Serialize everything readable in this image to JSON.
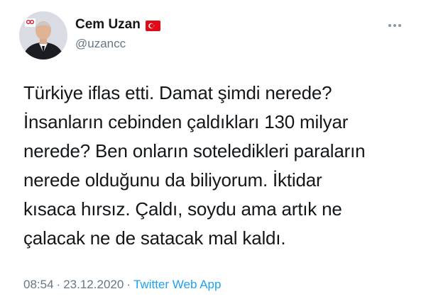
{
  "author": {
    "display_name": "Cem Uzan",
    "handle": "@uzancc",
    "flag_icon": "turkey-flag-icon",
    "avatar_icon": "profile-photo"
  },
  "more_menu_icon": "more-horizontal-icon",
  "tweet": {
    "text": "Türkiye iflas etti. Damat şimdi nerede?\nİnsanların cebinden çaldıkları 130 milyar\nnerede? Ben onların soteledikleri paraların\nnerede olduğunu da biliyorum. İktidar\nkısaca hırsız. Çaldı, soydu ama artık ne\nçalacak ne de satacak mal kaldı."
  },
  "meta": {
    "time": "08:54",
    "separator": "·",
    "date": "23.12.2020",
    "source": "Twitter Web App"
  },
  "colors": {
    "text": "#14171a",
    "secondary": "#657786",
    "link": "#1da1f2",
    "flag_red": "#e30a17"
  }
}
